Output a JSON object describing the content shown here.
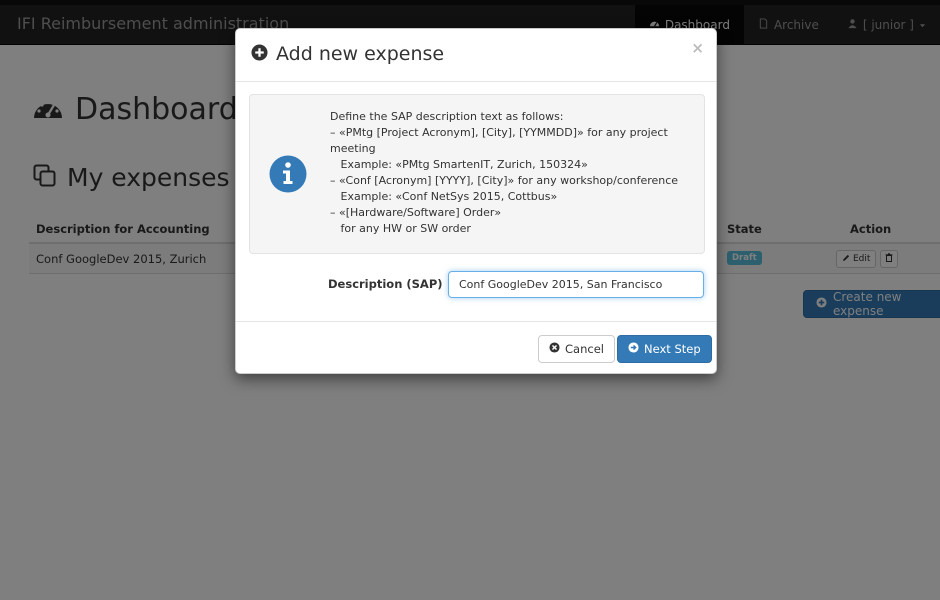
{
  "app": {
    "title": "IFI Reimbursement administration"
  },
  "nav": {
    "items": [
      {
        "label": "Dashboard",
        "icon": "dashboard-icon",
        "active": true
      },
      {
        "label": "Archive",
        "icon": "file-icon",
        "active": false
      },
      {
        "label": "[ junior ]",
        "icon": "user-icon",
        "active": false
      }
    ]
  },
  "page": {
    "title": "Dashboard",
    "section_title": "My expenses",
    "table": {
      "columns": [
        "Description for Accounting",
        "State",
        "Action"
      ],
      "rows": [
        {
          "description": "Conf GoogleDev 2015, Zurich",
          "state": "Draft",
          "edit_label": "Edit"
        }
      ]
    },
    "create_button": "Create new expense"
  },
  "modal": {
    "title": "Add new expense",
    "close": "×",
    "info_lines": [
      "Define the SAP description text as follows:",
      "– «PMtg [Project Acronym], [City], [YYMMDD]» for any project",
      "meeting",
      "   Example: «PMtg SmartenIT, Zurich, 150324»",
      "– «Conf [Acronym] [YYYY], [City]» for any workshop/conference",
      "   Example: «Conf NetSys 2015, Cottbus»",
      "– «[Hardware/Software] Order»",
      "   for any HW or SW order"
    ],
    "field_label": "Description (SAP)",
    "field_value": "Conf GoogleDev 2015, San Francisco",
    "cancel_label": "Cancel",
    "next_label": "Next Step"
  },
  "colors": {
    "primary": "#337ab7",
    "info_badge": "#5bc0de",
    "navbar": "#222222"
  }
}
